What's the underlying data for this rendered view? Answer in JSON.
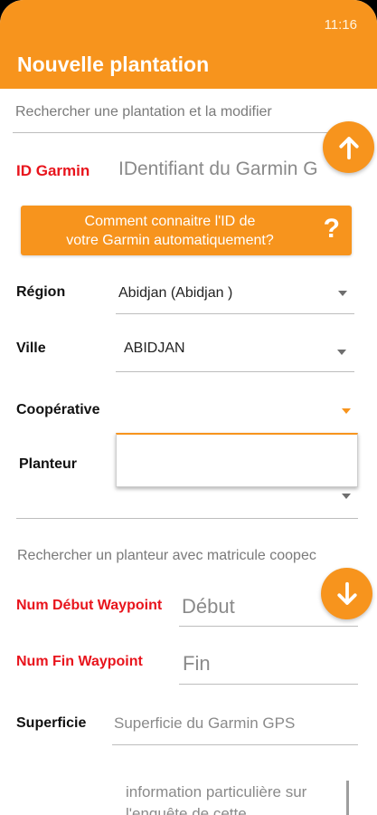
{
  "status_bar": {
    "time": "11:16"
  },
  "app_bar": {
    "title": "Nouvelle plantation"
  },
  "search_plantation": {
    "placeholder": "Rechercher une plantation et la modifier"
  },
  "garmin": {
    "label": "ID Garmin",
    "placeholder": "IDentifiant du Garmin G",
    "help_button": {
      "line1": "Comment connaitre l'ID de",
      "line2": "votre Garmin automatiquement?",
      "icon_text": "?"
    }
  },
  "region": {
    "label": "Région",
    "value": "Abidjan (Abidjan )"
  },
  "ville": {
    "label": "Ville",
    "value": "ABIDJAN"
  },
  "cooperative": {
    "label": "Coopérative",
    "value": ""
  },
  "planteur": {
    "label": "Planteur",
    "value": ""
  },
  "search_planteur": {
    "placeholder": "Rechercher un planteur avec matricule coopec"
  },
  "waypoint_start": {
    "label": "Num Début Waypoint",
    "placeholder": "Début"
  },
  "waypoint_end": {
    "label": "Num Fin Waypoint",
    "placeholder": "Fin"
  },
  "superficie": {
    "label": "Superficie",
    "placeholder": "Superficie du Garmin GPS"
  },
  "info": {
    "placeholder": "information particulière sur l'enquête de cette"
  },
  "icons": {
    "scroll_up": "arrow-up-icon",
    "scroll_down": "arrow-down-icon",
    "dropdown": "caret-down-icon"
  },
  "colors": {
    "accent": "#f7941d",
    "required_label": "#e8141c"
  }
}
